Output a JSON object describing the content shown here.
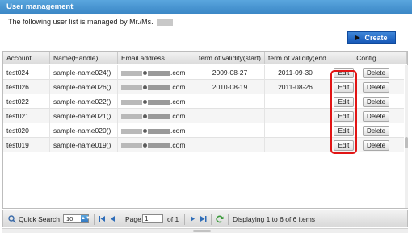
{
  "header": {
    "title": "User management"
  },
  "subtitle": {
    "text": "The following user list is managed by Mr./Ms."
  },
  "create_button": {
    "label": "Create"
  },
  "columns": [
    "Account",
    "Name(Handle)",
    "Email address",
    "term of validity(start)",
    "term of validity(end)",
    "Config"
  ],
  "rows": [
    {
      "account": "test024",
      "name": "sample-name024()",
      "email_domain": ".com",
      "start": "2009-08-27",
      "end": "2011-09-30"
    },
    {
      "account": "test026",
      "name": "sample-name026()",
      "email_domain": ".com",
      "start": "2010-08-19",
      "end": "2011-08-26"
    },
    {
      "account": "test022",
      "name": "sample-name022()",
      "email_domain": ".com",
      "start": "",
      "end": ""
    },
    {
      "account": "test021",
      "name": "sample-name021()",
      "email_domain": ".com",
      "start": "",
      "end": ""
    },
    {
      "account": "test020",
      "name": "sample-name020()",
      "email_domain": ".com",
      "start": "",
      "end": ""
    },
    {
      "account": "test019",
      "name": "sample-name019()",
      "email_domain": ".com",
      "start": "",
      "end": ""
    }
  ],
  "row_buttons": {
    "edit": "Edit",
    "delete": "Delete"
  },
  "footer": {
    "quick_search": "Quick Search",
    "page_size": "10",
    "page_label": "Page",
    "page_value": "1",
    "of_label": "of 1",
    "status": "Displaying 1 to 6 of 6 items"
  },
  "colors": {
    "header": "#3b87c6",
    "create_button": "#1859b8",
    "highlight": "#e11515"
  },
  "icons": [
    "search-icon",
    "first-page-icon",
    "prev-page-icon",
    "next-page-icon",
    "last-page-icon",
    "refresh-icon",
    "create-arrow-icon"
  ]
}
